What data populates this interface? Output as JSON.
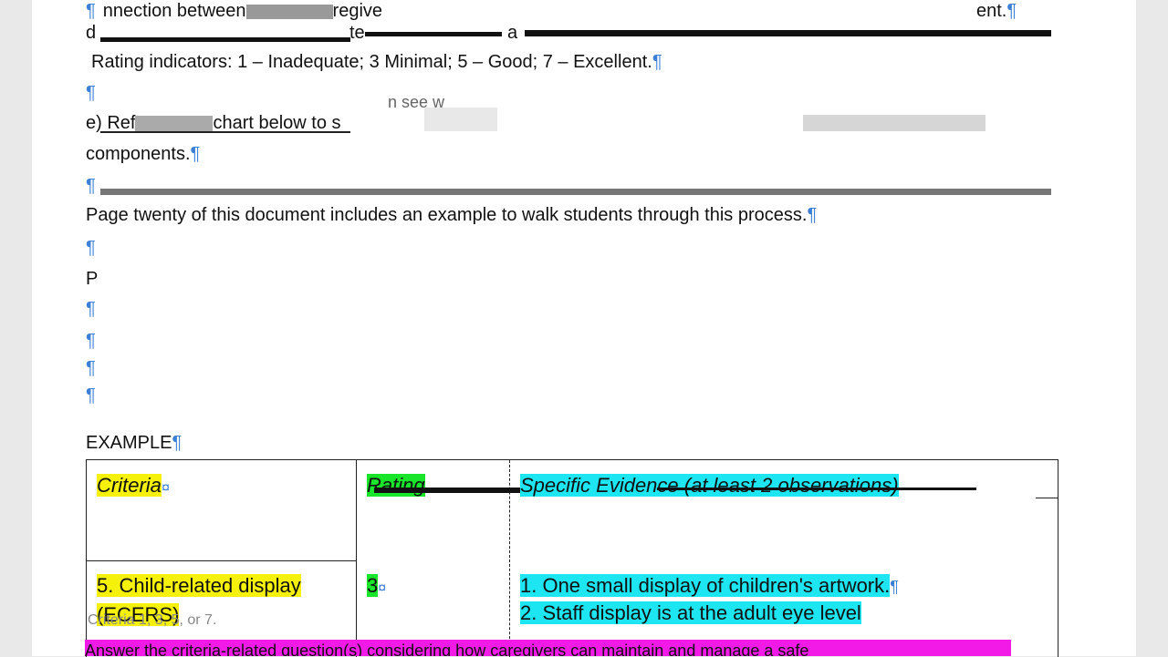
{
  "document": {
    "line1": "nnection between",
    "line1b": "regive",
    "line1c": "ent.",
    "line2a": "d",
    "line2b": "te",
    "line2c": "a",
    "rating_line": "Rating indicators: 1 – Inadequate; 3 Minimal; 5 – Good; 7 – Excellent.",
    "line_e_a": "e) Ref",
    "line_e_b": "chart below to s",
    "line_e_c": "n see w",
    "line_comp": "components.",
    "page_line": "Page twenty of this document includes an example to walk students through this process.",
    "line_p": "P",
    "example_label": "EXAMPLE",
    "pilcrow": "¶",
    "cell_mark": "¤",
    "bottom_text": "Answer the criteria-related question(s) considering how caregivers can maintain and manage a safe"
  },
  "table": {
    "header_criteria": "Criteria",
    "header_rating": "Rating",
    "header_evidence": "Specific Evidence (at least 2 observations)",
    "row1_criteria_line1": "5. Child-related display",
    "row1_criteria_line2": "(ECERS)",
    "row1_rating": "3",
    "row1_evidence_line1": "1. One small display of children's artwork.",
    "row1_evidence_line2": "2. Staff display is at the adult eye level",
    "scale_row": "Criteria 1, 3, 5, or 7."
  },
  "colors": {
    "yellow_highlight": "#f5f10a",
    "green_highlight": "#19e52a",
    "cyan_highlight": "#1de5f2",
    "magenta_highlight": "#f11ae6",
    "formatting_mark": "#3b7fd6"
  }
}
